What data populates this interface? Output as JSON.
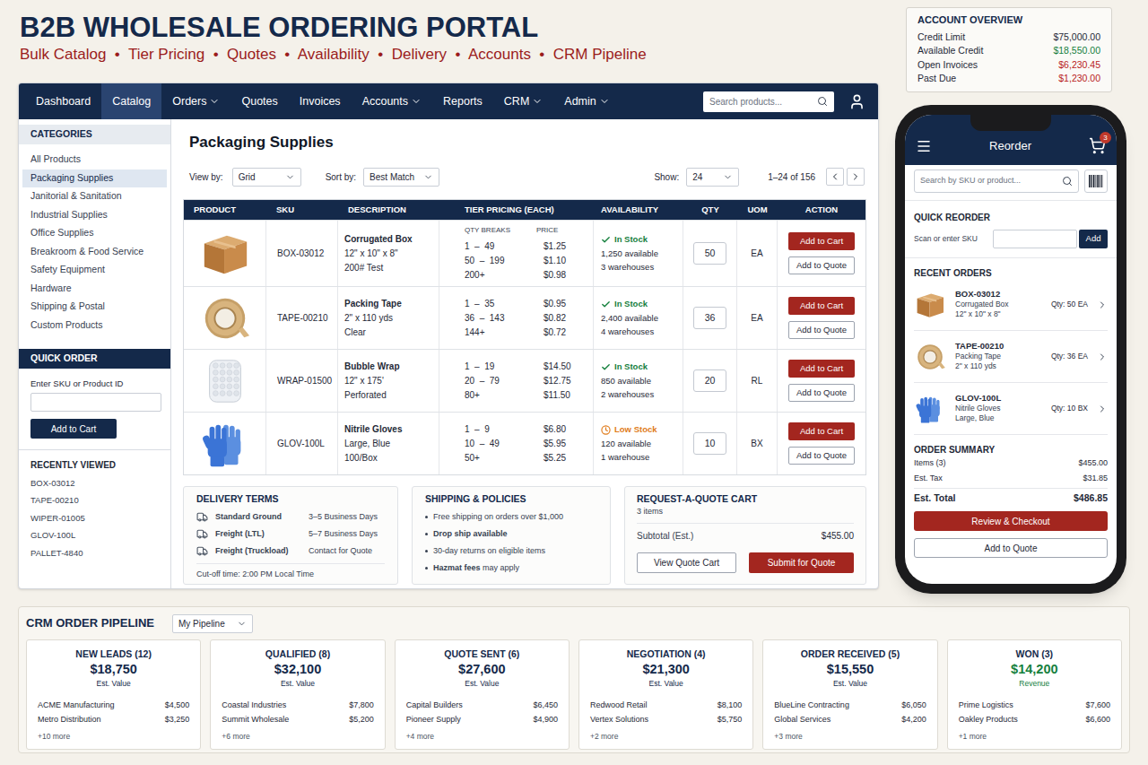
{
  "header": {
    "title": "B2B WHOLESALE ORDERING PORTAL",
    "subtitle": "Bulk Catalog  •  Tier Pricing  •  Quotes  •  Availability  •  Delivery  •  Accounts  •  CRM Pipeline"
  },
  "account_overview": {
    "title": "ACCOUNT OVERVIEW",
    "rows": [
      {
        "label": "Credit Limit",
        "value": "$75,000.00",
        "color": "#1f2937"
      },
      {
        "label": "Available Credit",
        "value": "$18,550.00",
        "color": "#15803d"
      },
      {
        "label": "Open Invoices",
        "value": "$6,230.45",
        "color": "#b91c1c"
      },
      {
        "label": "Past Due",
        "value": "$1,230.00",
        "color": "#b91c1c"
      }
    ]
  },
  "nav": {
    "items": [
      {
        "label": "Dashboard",
        "dropdown": false,
        "selected": false
      },
      {
        "label": "Catalog",
        "dropdown": false,
        "selected": true
      },
      {
        "label": "Orders",
        "dropdown": true,
        "selected": false
      },
      {
        "label": "Quotes",
        "dropdown": false,
        "selected": false
      },
      {
        "label": "Invoices",
        "dropdown": false,
        "selected": false
      },
      {
        "label": "Accounts",
        "dropdown": true,
        "selected": false
      },
      {
        "label": "Reports",
        "dropdown": false,
        "selected": false
      },
      {
        "label": "CRM",
        "dropdown": true,
        "selected": false
      },
      {
        "label": "Admin",
        "dropdown": true,
        "selected": false
      }
    ],
    "search_placeholder": "Search products..."
  },
  "sidebar": {
    "categories_title": "CATEGORIES",
    "categories": [
      {
        "label": "All Products",
        "selected": false
      },
      {
        "label": "Packaging Supplies",
        "selected": true
      },
      {
        "label": "Janitorial & Sanitation",
        "selected": false
      },
      {
        "label": "Industrial Supplies",
        "selected": false
      },
      {
        "label": "Office Supplies",
        "selected": false
      },
      {
        "label": "Breakroom & Food Service",
        "selected": false
      },
      {
        "label": "Safety Equipment",
        "selected": false
      },
      {
        "label": "Hardware",
        "selected": false
      },
      {
        "label": "Shipping & Postal",
        "selected": false
      },
      {
        "label": "Custom Products",
        "selected": false
      }
    ],
    "quick_order": {
      "title": "QUICK ORDER",
      "label": "Enter SKU or Product ID",
      "button": "Add to Cart"
    },
    "recently_viewed": {
      "title": "RECENTLY VIEWED",
      "items": [
        "BOX-03012",
        "TAPE-00210",
        "WIPER-01005",
        "GLOV-100L",
        "PALLET-4840"
      ]
    }
  },
  "catalog": {
    "heading": "Packaging Supplies",
    "toolbar": {
      "view_label": "View by:",
      "view_value": "Grid",
      "sort_label": "Sort by:",
      "sort_value": "Best Match",
      "show_label": "Show:",
      "show_value": "24",
      "range": "1–24 of 156"
    },
    "columns": [
      "PRODUCT",
      "SKU",
      "DESCRIPTION",
      "TIER PRICING (EACH)",
      "AVAILABILITY",
      "QTY",
      "UOM",
      "ACTION"
    ],
    "tier_subheaders": [
      "QTY BREAKS",
      "PRICE"
    ],
    "actions": {
      "add_to_cart": "Add to Cart",
      "add_to_quote": "Add to Quote"
    },
    "rows": [
      {
        "image": "box",
        "sku": "BOX-03012",
        "description": [
          "Corrugated Box",
          "12\" x 10\" x 8\"",
          "200# Test"
        ],
        "tiers": [
          {
            "qty": "1  –  49",
            "price": "$1.25"
          },
          {
            "qty": "50  –  199",
            "price": "$1.10"
          },
          {
            "qty": "200+",
            "price": "$0.98"
          }
        ],
        "availability": {
          "kind": "in-stock",
          "status": "In Stock",
          "available": "1,250 available",
          "warehouses": "3 warehouses",
          "color": "#15803d"
        },
        "qty": "50",
        "uom": "EA"
      },
      {
        "image": "tape",
        "sku": "TAPE-00210",
        "description": [
          "Packing Tape",
          "2\" x 110 yds",
          "Clear"
        ],
        "tiers": [
          {
            "qty": "1  –  35",
            "price": "$0.95"
          },
          {
            "qty": "36  –  143",
            "price": "$0.82"
          },
          {
            "qty": "144+",
            "price": "$0.72"
          }
        ],
        "availability": {
          "kind": "in-stock",
          "status": "In Stock",
          "available": "2,400 available",
          "warehouses": "4 warehouses",
          "color": "#15803d"
        },
        "qty": "36",
        "uom": "EA"
      },
      {
        "image": "wrap",
        "sku": "WRAP-01500",
        "description": [
          "Bubble Wrap",
          "12\" x 175'",
          "Perforated"
        ],
        "tiers": [
          {
            "qty": "1  –  19",
            "price": "$14.50"
          },
          {
            "qty": "20  –  79",
            "price": "$12.75"
          },
          {
            "qty": "80+",
            "price": "$11.50"
          }
        ],
        "availability": {
          "kind": "in-stock",
          "status": "In Stock",
          "available": "850 available",
          "warehouses": "2 warehouses",
          "color": "#15803d"
        },
        "qty": "20",
        "uom": "RL"
      },
      {
        "image": "gloves",
        "sku": "GLOV-100L",
        "description": [
          "Nitrile Gloves",
          "Large, Blue",
          "100/Box"
        ],
        "tiers": [
          {
            "qty": "1  –  9",
            "price": "$6.80"
          },
          {
            "qty": "10  –  49",
            "price": "$5.95"
          },
          {
            "qty": "50+",
            "price": "$5.25"
          }
        ],
        "availability": {
          "kind": "low-stock",
          "status": "Low Stock",
          "available": "120 available",
          "warehouses": "1 warehouse",
          "color": "#e07b1a"
        },
        "qty": "10",
        "uom": "BX"
      }
    ],
    "delivery": {
      "title": "DELIVERY TERMS",
      "rows": [
        {
          "method": "Standard Ground",
          "time": "3–5 Business Days"
        },
        {
          "method": "Freight (LTL)",
          "time": "5–7 Business Days"
        },
        {
          "method": "Freight (Truckload)",
          "time": "Contact for Quote"
        }
      ],
      "cutoff": "Cut-off time: 2:00 PM Local Time"
    },
    "shipping": {
      "title": "SHIPPING & POLICIES",
      "bullets": [
        [
          {
            "text": "Free shipping on orders over $1,000",
            "bold": false
          }
        ],
        [
          {
            "text": "Drop ship available",
            "bold": true
          }
        ],
        [
          {
            "text": "30-day returns on eligible items",
            "bold": false
          }
        ],
        [
          {
            "text": "Hazmat fees",
            "bold": true
          },
          {
            "text": " may apply",
            "bold": false
          }
        ]
      ]
    },
    "quote_cart": {
      "title": "REQUEST-A-QUOTE CART",
      "count": "3 items",
      "subtotal_label": "Subtotal (Est.)",
      "subtotal": "$455.00",
      "view_button": "View Quote Cart",
      "submit_button": "Submit for Quote"
    }
  },
  "phone": {
    "title": "Reorder",
    "cart_badge": "3",
    "search_placeholder": "Search by SKU or product...",
    "quick_reorder": {
      "title": "QUICK REORDER",
      "label": "Scan or enter SKU",
      "button": "Add"
    },
    "recent_title": "RECENT ORDERS",
    "recent": [
      {
        "image": "box",
        "sku": "BOX-03012",
        "name": "Corrugated Box",
        "size": "12\" x 10\" x 8\"",
        "qty": "Qty: 50 EA"
      },
      {
        "image": "tape",
        "sku": "TAPE-00210",
        "name": "Packing Tape",
        "size": "2\" x 110 yds",
        "qty": "Qty: 36 EA"
      },
      {
        "image": "gloves",
        "sku": "GLOV-100L",
        "name": "Nitrile Gloves",
        "size": "Large, Blue",
        "qty": "Qty: 10 BX"
      }
    ],
    "summary": {
      "title": "ORDER SUMMARY",
      "rows": [
        {
          "label": "Items (3)",
          "value": "$455.00"
        },
        {
          "label": "Est. Tax",
          "value": "$31.85"
        }
      ],
      "total_label": "Est. Total",
      "total": "$486.85",
      "checkout_button": "Review & Checkout",
      "quote_button": "Add to Quote"
    }
  },
  "crm": {
    "title": "CRM ORDER PIPELINE",
    "filter": "My Pipeline",
    "stages": [
      {
        "name": "NEW LEADS (12)",
        "value": "$18,750",
        "value_label": "Est. Value",
        "color": "#14294a",
        "deals": [
          {
            "name": "ACME Manufacturing",
            "value": "$4,500"
          },
          {
            "name": "Metro Distribution",
            "value": "$3,250"
          }
        ],
        "more": "+10 more"
      },
      {
        "name": "QUALIFIED (8)",
        "value": "$32,100",
        "value_label": "Est. Value",
        "color": "#14294a",
        "deals": [
          {
            "name": "Coastal Industries",
            "value": "$7,800"
          },
          {
            "name": "Summit Wholesale",
            "value": "$5,200"
          }
        ],
        "more": "+6 more"
      },
      {
        "name": "QUOTE SENT (6)",
        "value": "$27,600",
        "value_label": "Est. Value",
        "color": "#14294a",
        "deals": [
          {
            "name": "Capital Builders",
            "value": "$6,450"
          },
          {
            "name": "Pioneer Supply",
            "value": "$4,900"
          }
        ],
        "more": "+4 more"
      },
      {
        "name": "NEGOTIATION (4)",
        "value": "$21,300",
        "value_label": "Est. Value",
        "color": "#14294a",
        "deals": [
          {
            "name": "Redwood Retail",
            "value": "$8,100"
          },
          {
            "name": "Vertex Solutions",
            "value": "$5,750"
          }
        ],
        "more": "+2 more"
      },
      {
        "name": "ORDER RECEIVED (5)",
        "value": "$15,550",
        "value_label": "Est. Value",
        "color": "#14294a",
        "deals": [
          {
            "name": "BlueLine Contracting",
            "value": "$6,050"
          },
          {
            "name": "Global Services",
            "value": "$4,200"
          }
        ],
        "more": "+3 more"
      },
      {
        "name": "WON (3)",
        "value": "$14,200",
        "value_label": "Revenue",
        "color": "#15803d",
        "deals": [
          {
            "name": "Prime Logistics",
            "value": "$7,600"
          },
          {
            "name": "Oakley Products",
            "value": "$6,600"
          }
        ],
        "more": "+1 more"
      }
    ]
  }
}
